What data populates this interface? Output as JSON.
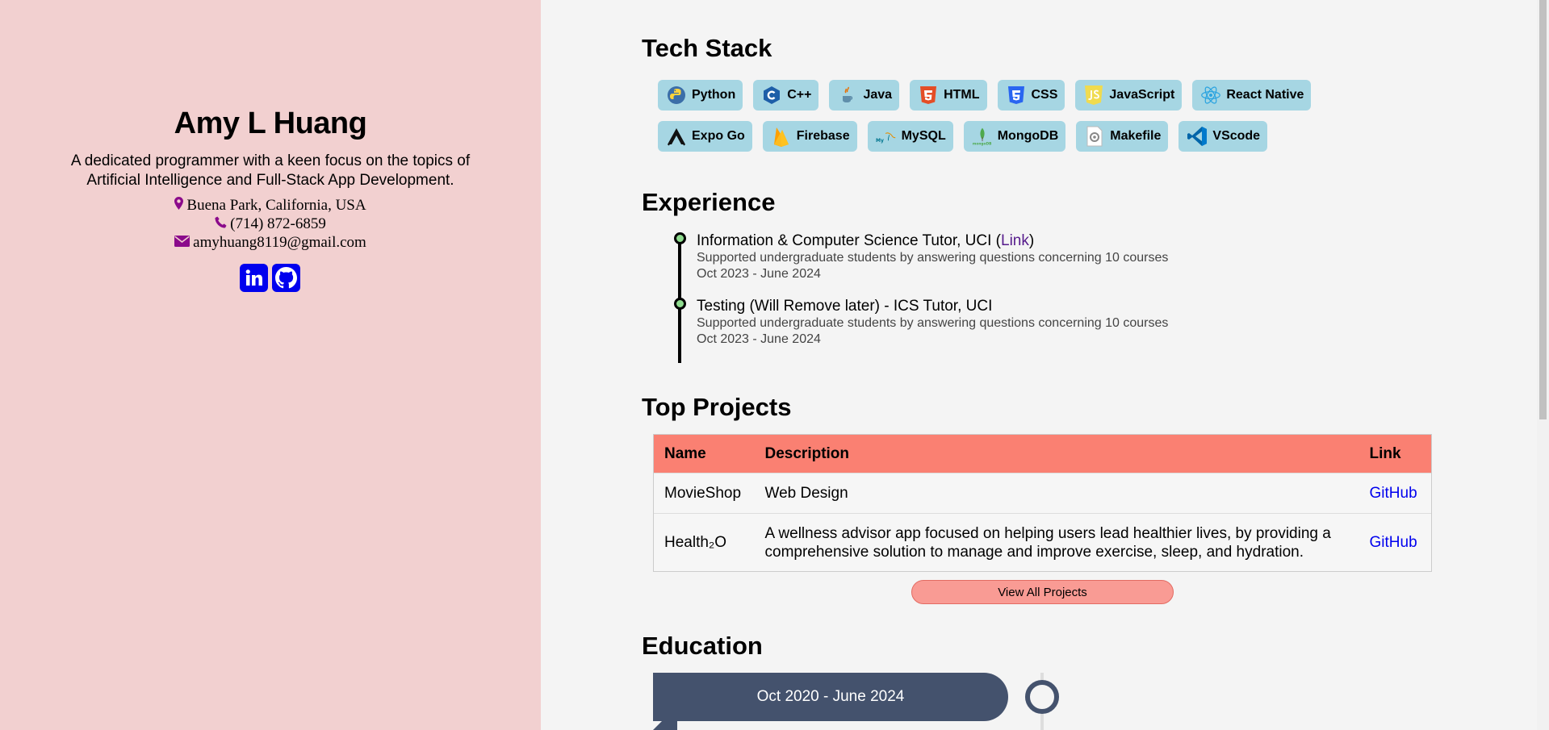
{
  "profile": {
    "name": "Amy L Huang",
    "tagline": "A dedicated programmer with a keen focus on the topics of Artificial Intelligence and Full-Stack App Development.",
    "location": "Buena Park, California, USA",
    "phone": "(714) 872-6859",
    "email": "amyhuang8119@gmail.com",
    "socials": [
      {
        "name": "LinkedIn",
        "icon": "linkedin-icon"
      },
      {
        "name": "GitHub",
        "icon": "github-icon"
      }
    ]
  },
  "tech_stack": {
    "title": "Tech Stack",
    "row1": [
      "Python",
      "C++",
      "Java",
      "HTML",
      "CSS",
      "JavaScript",
      "React Native"
    ],
    "row2": [
      "Expo Go",
      "Firebase",
      "MySQL",
      "MongoDB",
      "Makefile",
      "VScode"
    ]
  },
  "experience": {
    "title": "Experience",
    "items": [
      {
        "title": "Information & Computer Science Tutor, UCI (",
        "link": "Link",
        "title_end": ")",
        "desc": "Supported undergraduate students by answering questions concerning 10 courses",
        "dates": "Oct 2023 - June 2024"
      },
      {
        "title": "Testing (Will Remove later) - ICS Tutor, UCI",
        "desc": "Supported undergraduate students by answering questions concerning 10 courses",
        "dates": "Oct 2023 - June 2024"
      }
    ]
  },
  "projects": {
    "title": "Top Projects",
    "headers": [
      "Name",
      "Description",
      "Link"
    ],
    "rows": [
      {
        "name": "MovieShop",
        "desc": "Web Design",
        "link": "GitHub"
      },
      {
        "name": "Health₂O",
        "desc": "A wellness advisor app focused on helping users lead healthier lives, by providing a comprehensive solution to manage and improve exercise, sleep, and hydration.",
        "link": "GitHub"
      }
    ],
    "view_all": "View All Projects"
  },
  "education": {
    "title": "Education",
    "dates": "Oct 2020 - June 2024"
  },
  "colors": {
    "left_panel": "#f2d0d0",
    "chip": "#a6d6e3",
    "table_header": "#fa8072",
    "timeline_dot": "#8fdc8f",
    "education_card": "#44526d",
    "contact_icon": "#8b0a8b",
    "social_button": "#0000ee"
  }
}
